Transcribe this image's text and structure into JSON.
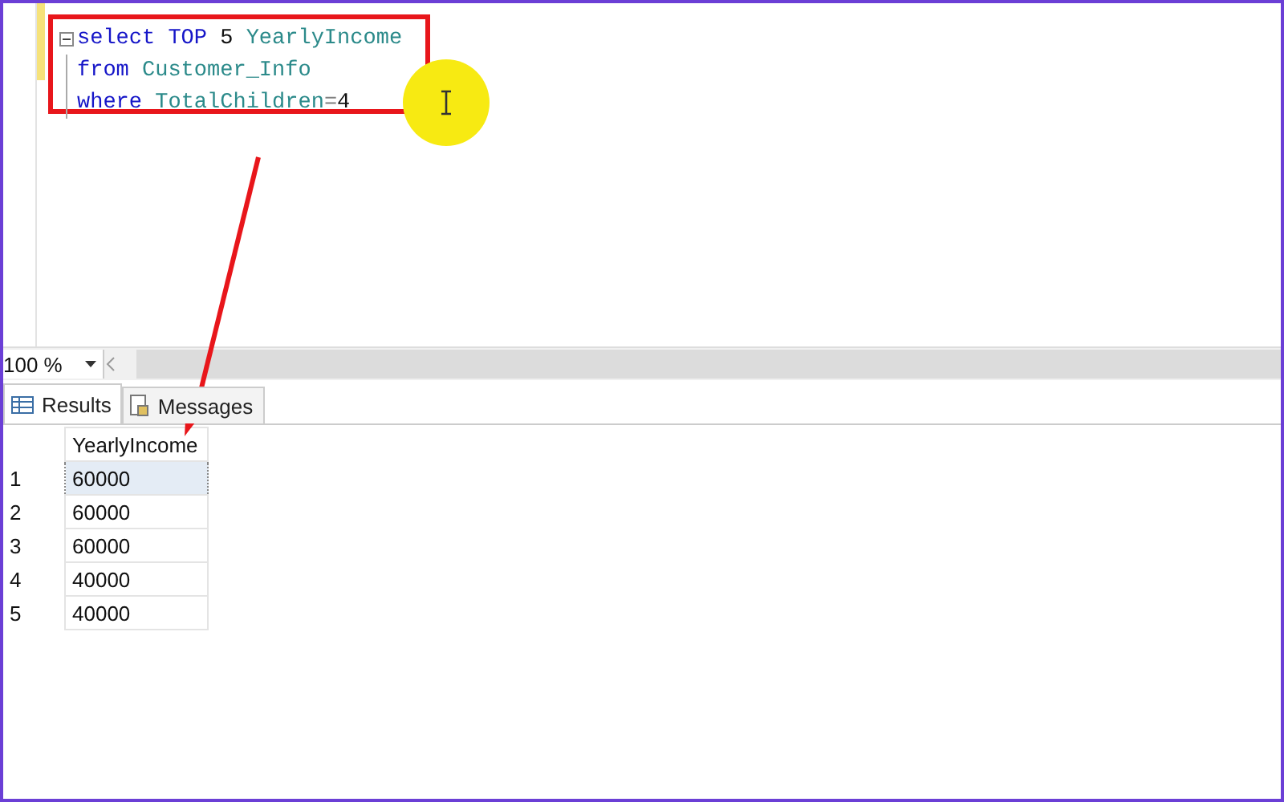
{
  "editor": {
    "lines": [
      {
        "collapsible": true,
        "tokens": [
          {
            "text": "select",
            "kind": "keyword"
          },
          {
            "text": " TOP",
            "kind": "keyword"
          },
          {
            "text": " 5 ",
            "kind": "plain"
          },
          {
            "text": "YearlyIncome",
            "kind": "identifier"
          }
        ]
      },
      {
        "collapsible": false,
        "tokens": [
          {
            "text": "from",
            "kind": "keyword"
          },
          {
            "text": " Customer_Info",
            "kind": "identifier"
          }
        ]
      },
      {
        "collapsible": false,
        "tokens": [
          {
            "text": "where",
            "kind": "keyword"
          },
          {
            "text": " TotalChildren",
            "kind": "identifier"
          },
          {
            "text": "=",
            "kind": "operator"
          },
          {
            "text": "4",
            "kind": "plain"
          }
        ]
      }
    ]
  },
  "zoom": {
    "value": "100 %"
  },
  "result_tabs": [
    {
      "label": "Results",
      "selected": true
    },
    {
      "label": "Messages",
      "selected": false
    }
  ],
  "grid": {
    "columns": [
      "YearlyIncome"
    ],
    "rows": [
      {
        "number": "1",
        "value": "60000",
        "selected": true
      },
      {
        "number": "2",
        "value": "60000",
        "selected": false
      },
      {
        "number": "3",
        "value": "60000",
        "selected": false
      },
      {
        "number": "4",
        "value": "40000",
        "selected": false
      },
      {
        "number": "5",
        "value": "40000",
        "selected": false
      }
    ]
  }
}
